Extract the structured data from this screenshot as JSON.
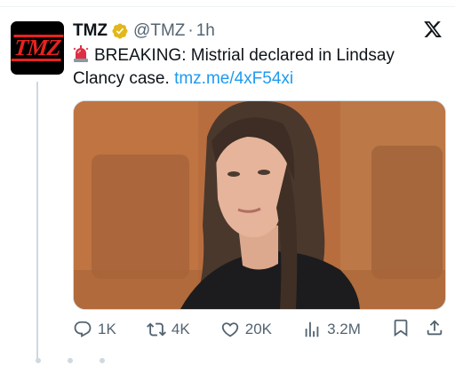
{
  "author": {
    "display_name": "TMZ",
    "handle": "@TMZ",
    "separator": "·",
    "time": "1h",
    "avatar_text": "TMZ"
  },
  "tweet": {
    "emoji_icon": "police-light-icon",
    "text_main": "BREAKING: Mistrial declared in Lindsay Clancy case.",
    "link": "tmz.me/4xF54xi"
  },
  "actions": {
    "replies": "1K",
    "retweets": "4K",
    "likes": "20K",
    "views": "3.2M"
  },
  "colors": {
    "link": "#1d9bf0",
    "verified_gold": "#e2b719",
    "muted": "#536471",
    "brand_red": "#e6231f"
  }
}
